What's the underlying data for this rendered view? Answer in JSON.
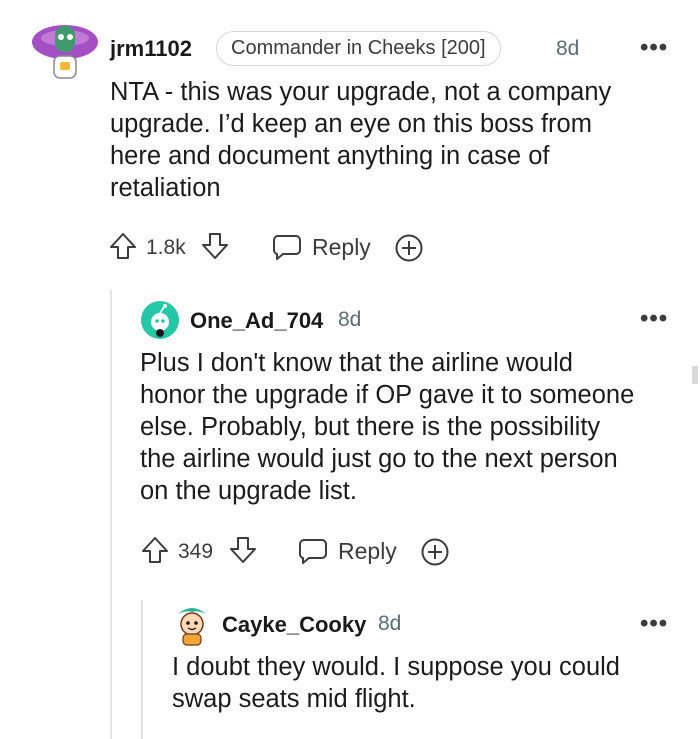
{
  "comments": [
    {
      "username": "jrm1102",
      "flair": "Commander in Cheeks [200]",
      "age": "8d",
      "body_lines": [
        "NTA - this was your upgrade, not a company",
        "upgrade. I’d keep an eye on this boss from",
        "here and document anything in case of",
        "retaliation"
      ],
      "score": "1.8k",
      "reply_label": "Reply",
      "more_label": "•••"
    },
    {
      "username": "One_Ad_704",
      "age": "8d",
      "body_lines": [
        "Plus I don't know that the airline would",
        "honor the upgrade if OP gave it to someone",
        "else. Probably, but there is the possibility",
        "the airline would just go to the next person",
        "on the upgrade list."
      ],
      "score": "349",
      "reply_label": "Reply",
      "more_label": "•••"
    },
    {
      "username": "Cayke_Cooky",
      "age": "8d",
      "body_lines": [
        "I doubt they would. I suppose you could",
        "swap seats mid flight."
      ],
      "more_label": "•••"
    }
  ],
  "icons": {
    "upvote": "upvote-icon",
    "downvote": "downvote-icon",
    "reply": "speech-bubble-icon",
    "award": "plus-circle-icon"
  },
  "colors": {
    "avatar_purple": "#a44fc4",
    "avatar_green": "#3f9a6e",
    "avatar_teal": "#24c7a6"
  }
}
